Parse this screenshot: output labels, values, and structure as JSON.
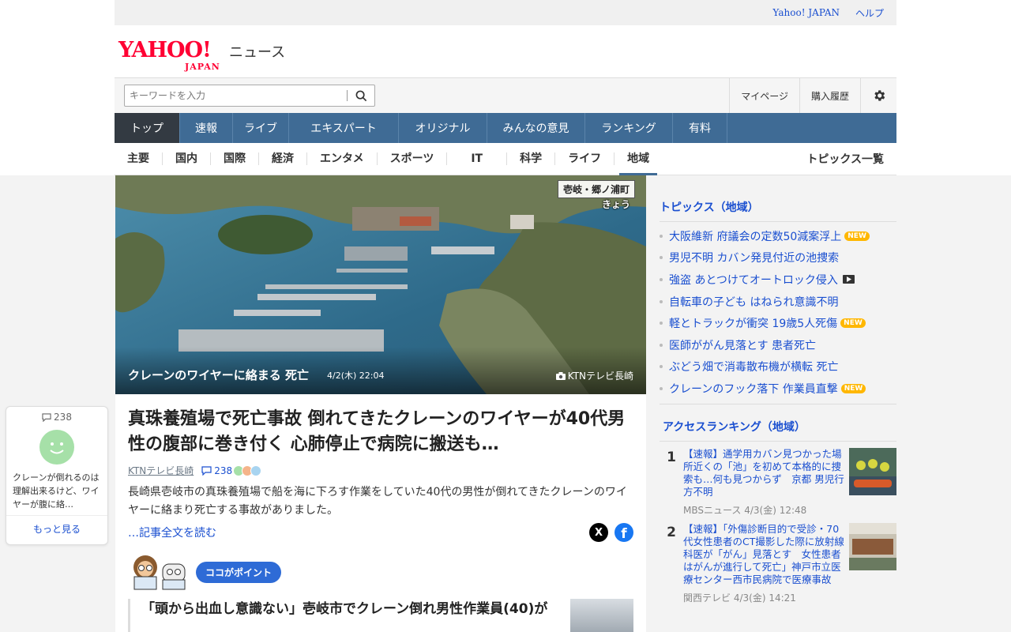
{
  "utility": {
    "links": [
      "Yahoo! JAPAN",
      "ヘルプ"
    ]
  },
  "brand": {
    "logo_main": "YAHOO!",
    "logo_sub": "JAPAN",
    "section": "ニュース"
  },
  "search": {
    "placeholder": "キーワードを入力"
  },
  "header_links": [
    "マイページ",
    "購入履歴"
  ],
  "global_nav": [
    "トップ",
    "速報",
    "ライブ",
    "エキスパート",
    "オリジナル",
    "みんなの意見",
    "ランキング",
    "有料"
  ],
  "sub_nav": [
    "主要",
    "国内",
    "国際",
    "経済",
    "エンタメ",
    "スポーツ",
    "IT",
    "科学",
    "ライフ",
    "地域"
  ],
  "sub_nav_more": "トピックス一覧",
  "hero": {
    "caption": "クレーンのワイヤーに絡まる 死亡",
    "date": "4/2(木) 22:04",
    "credit": "KTNテレビ長崎",
    "tag_location": "壱岐・郷ノ浦町",
    "tag_time": "きょう"
  },
  "article": {
    "headline": "真珠養殖場で死亡事故 倒れてきたクレーンのワイヤーが40代男性の腹部に巻き付く 心肺停止で病院に搬送も…",
    "source": "KTNテレビ長崎",
    "comment_count": "238",
    "summary": "長崎県壱岐市の真珠養殖場で船を海に下ろす作業をしていた40代の男性が倒れてきたクレーンのワイヤーに絡まり死亡する事故がありました。",
    "read_more": "…記事全文を読む",
    "share_x": "X",
    "share_fb": "f",
    "point_label": "ココがポイント",
    "related_title": "「頭から出血し意識ない」壱岐市でクレーン倒れ男性作業員(40)が"
  },
  "topics": {
    "heading": "トピックス（地域）",
    "items": [
      {
        "title": "大阪維新 府議会の定数50減案浮上",
        "badge": "NEW"
      },
      {
        "title": "男児不明 カバン発見付近の池捜索",
        "badge": ""
      },
      {
        "title": "強盗 あとつけてオートロック侵入",
        "badge": "video"
      },
      {
        "title": "自転車の子ども はねられ意識不明",
        "badge": ""
      },
      {
        "title": "軽とトラックが衝突 19歳5人死傷",
        "badge": "NEW"
      },
      {
        "title": "医師ががん見落とす 患者死亡",
        "badge": ""
      },
      {
        "title": "ぶどう畑で消毒散布機が横転 死亡",
        "badge": ""
      },
      {
        "title": "クレーンのフック落下 作業員直撃",
        "badge": "NEW"
      }
    ]
  },
  "ranking": {
    "heading": "アクセスランキング（地域）",
    "items": [
      {
        "rank": "1",
        "title": "【速報】通学用カバン見つかった場所近くの「池」を初めて本格的に捜索も…何も見つからず　京都 男児行方不明",
        "source": "MBSニュース",
        "date": "4/3(金) 12:48"
      },
      {
        "rank": "2",
        "title": "【速報】「外傷診断目的で受診・70代女性患者のCT撮影した際に放射線科医が「がん」見落とす　女性患者はがんが進行して死亡」神戸市立医療センター西市民病院で医療事故",
        "source": "関西テレビ",
        "date": "4/3(金) 14:21"
      }
    ]
  },
  "floating_comment": {
    "count": "238",
    "text": "クレーンが倒れるのは理解出来るけど、ワイヤーが腹に絡…",
    "more": "もっと見る"
  },
  "colors": {
    "nav_blue": "#3f6b95",
    "nav_active": "#333a42",
    "link_blue": "#1a4fd0",
    "brand_red": "#ff0033",
    "new_badge": "#ffb700"
  }
}
